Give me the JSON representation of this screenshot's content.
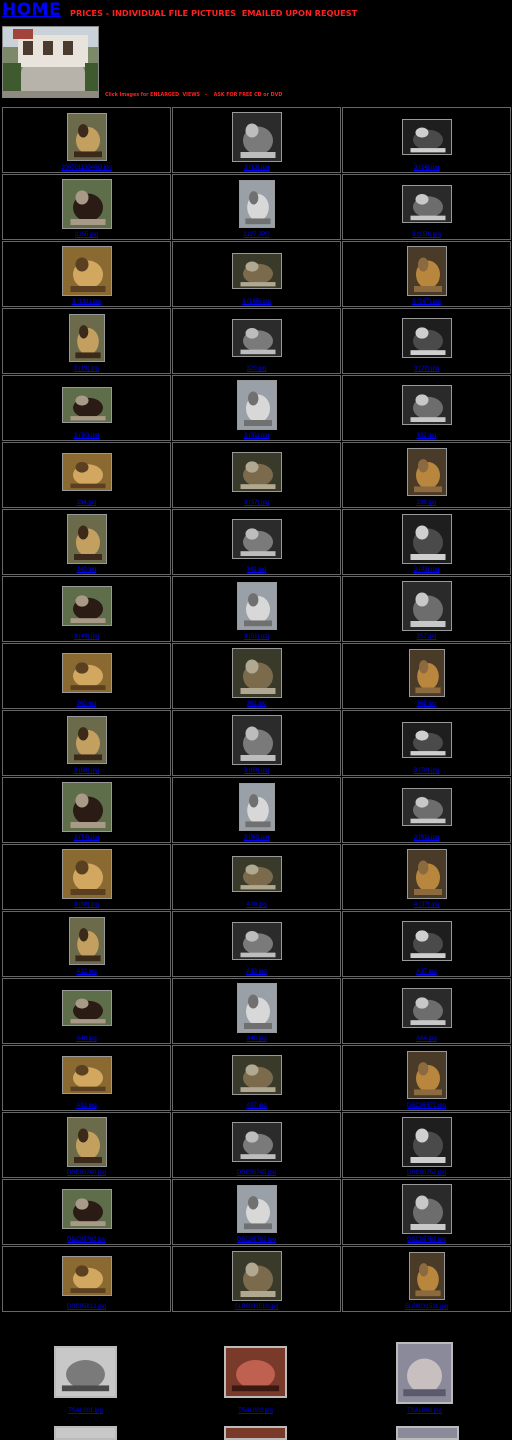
{
  "header": {
    "home_label": "HOME",
    "title": "PRICES - INDIVIDUAL FILE PICTURES  EMAILED UPON REQUEST",
    "click_note": "Click Images for ENLARGED  VIEWS   -    ASK FOR FREE CD or DVD"
  },
  "grid": {
    "rows": [
      [
        "20070113046Q.jpg",
        "3 (13).jpg",
        "3 (14).jpg"
      ],
      [
        "3155.jpg",
        "3127.JPG",
        "3 (159).jpg"
      ],
      [
        "3 (161).jpg",
        "3 (165).jpg",
        "3 (167).jpg"
      ],
      [
        "3 (19).jpg",
        "320.jpg",
        "3 (22).jpg"
      ],
      [
        "3 (30).jpg",
        "3 (31).jpg",
        "332.jpg"
      ],
      [
        "334.jpg",
        "3 (37).jpg",
        "338.jpg"
      ],
      [
        "340.jpg",
        "341.jpg",
        "3 (43).jpg"
      ],
      [
        "3 (49).jpg",
        "3 (51).jpg",
        "357.jpg"
      ],
      [
        "360.jpg",
        "361.jpg",
        "365.jpg"
      ],
      [
        "3 (68).jpg",
        "3 (69).jpg",
        "3 (70).jpg"
      ],
      [
        "3 (74).jpg",
        "3 (80).jpg",
        "3 (81).jpg"
      ],
      [
        "3 (88).jpg",
        "A10.jpg",
        "A (37).jpg"
      ],
      [
        "A12.jpg",
        "A33.jpg",
        "A37.jpg"
      ],
      [
        "A48.jpg",
        "A49.jpg",
        "A64.jpg"
      ],
      [
        "A93.jpg",
        "A97.jpg",
        "DSC05672.jpg"
      ],
      [
        "DSC05740.jpg",
        "DSC05745.jpg",
        "DSC05752.jpg"
      ],
      [
        "DSC05782.jpg",
        "DSC05782.jpg",
        "DSC05783.jpg"
      ],
      [
        "DSC05812.jpg",
        "SL08031510.jpg",
        "SL08031511.jpg"
      ]
    ]
  },
  "lower": {
    "items": [
      "TSAL001.jpg",
      "TSAL002.jpg",
      "TSAL003.jpg"
    ]
  }
}
